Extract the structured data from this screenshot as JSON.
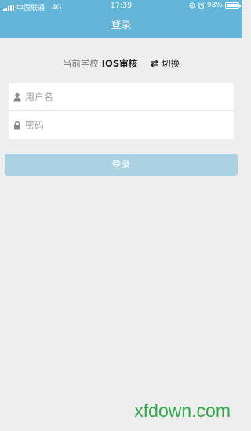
{
  "status_bar": {
    "carrier": "中国联通",
    "network": "4G",
    "time": "17:39",
    "battery": "98%",
    "battery_level": 0.98
  },
  "header": {
    "title": "登录",
    "background_color": "#63b6d8"
  },
  "school": {
    "label": "当前学校:",
    "name": "IOS审核",
    "switch_label": "切换",
    "switch_icon": "swap-arrows-icon"
  },
  "form": {
    "username_placeholder": "用户名",
    "username_icon": "user-icon",
    "password_placeholder": "密码",
    "password_icon": "lock-icon"
  },
  "login_button": {
    "label": "登录",
    "color": "#a9d1e2"
  },
  "watermark": "xfdown.com"
}
